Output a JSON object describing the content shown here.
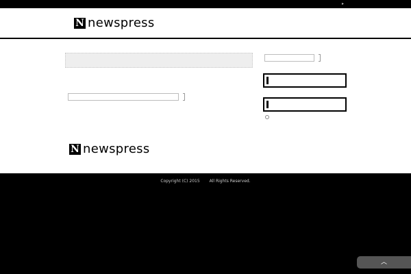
{
  "topbar": {
    "arrow": "▸"
  },
  "header": {
    "logo_mark": "N",
    "logo_word": "newspress"
  },
  "footer": {
    "logo_mark": "N",
    "logo_word": "newspress",
    "copyright": "Copyright (C) 2015",
    "rights": "All Rights Reserved."
  },
  "to_top": {
    "label": "︿"
  }
}
